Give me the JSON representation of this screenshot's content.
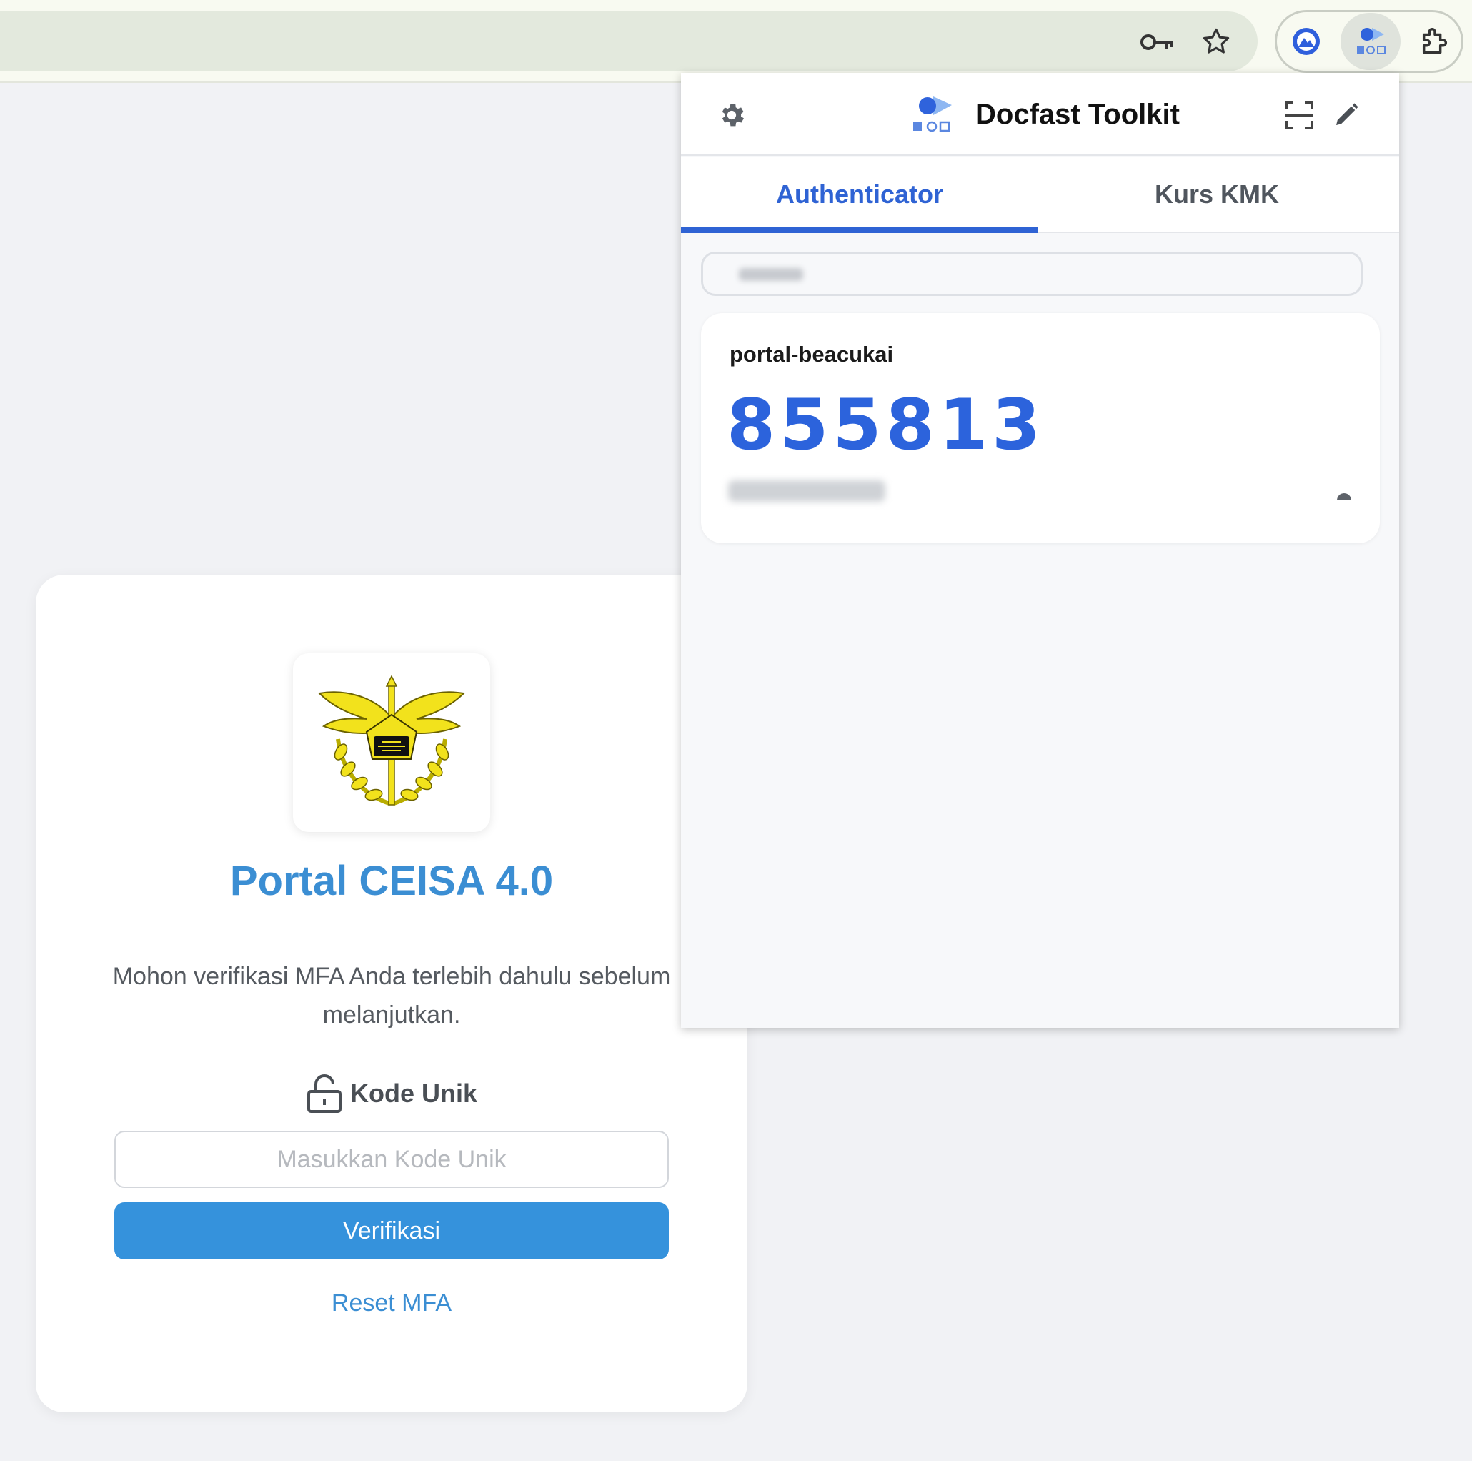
{
  "toolbar": {
    "icons": [
      "key-icon",
      "star-icon",
      "vpn-extension-icon",
      "docfast-extension-icon",
      "puzzle-icon"
    ]
  },
  "page": {
    "title": "Portal CEISA 4.0",
    "description": "Mohon verifikasi MFA Anda terlebih dahulu sebelum melanjutkan.",
    "code_label": "Kode Unik",
    "code_placeholder": "Masukkan Kode Unik",
    "verify_label": "Verifikasi",
    "reset_label": "Reset MFA"
  },
  "popup": {
    "title": "Docfast Toolkit",
    "tabs": [
      {
        "label": "Authenticator",
        "active": true
      },
      {
        "label": "Kurs KMK",
        "active": false
      }
    ],
    "entry": {
      "name": "portal-beacukai",
      "code": "855813"
    }
  },
  "colors": {
    "accent_blue": "#2c63dc",
    "portal_blue": "#3b8ed3",
    "button_blue": "#3592dc",
    "emblem_yellow": "#f2e21c"
  }
}
